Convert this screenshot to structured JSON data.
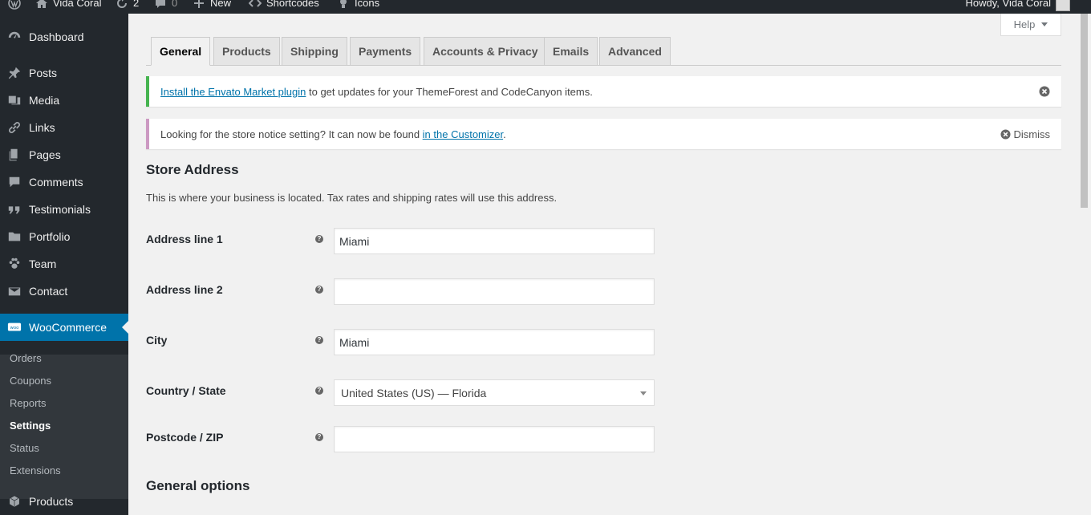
{
  "admin_bar": {
    "site_name": "Vida Coral",
    "updates_count": "2",
    "comments_count": "0",
    "new_label": "New",
    "shortcodes_label": "Shortcodes",
    "icons_label": "Icons",
    "howdy": "Howdy, Vida Coral"
  },
  "sidebar": {
    "menu": [
      {
        "label": "Dashboard",
        "icon": "dashboard-icon"
      },
      {
        "label": "Posts",
        "icon": "pin-icon"
      },
      {
        "label": "Media",
        "icon": "media-icon"
      },
      {
        "label": "Links",
        "icon": "link-icon"
      },
      {
        "label": "Pages",
        "icon": "pages-icon"
      },
      {
        "label": "Comments",
        "icon": "comment-icon"
      },
      {
        "label": "Testimonials",
        "icon": "quote-icon"
      },
      {
        "label": "Portfolio",
        "icon": "folder-icon"
      },
      {
        "label": "Team",
        "icon": "paw-icon"
      },
      {
        "label": "Contact",
        "icon": "mail-icon"
      },
      {
        "label": "WooCommerce",
        "icon": "woo-icon"
      },
      {
        "label": "Products",
        "icon": "cube-icon"
      }
    ],
    "submenu": [
      "Orders",
      "Coupons",
      "Reports",
      "Settings",
      "Status",
      "Extensions"
    ],
    "active_submenu": "Settings"
  },
  "help_label": "Help",
  "tabs": [
    "General",
    "Products",
    "Shipping",
    "Payments",
    "Accounts & Privacy",
    "Emails",
    "Advanced"
  ],
  "active_tab": "General",
  "notices": {
    "envato_link": "Install the Envato Market plugin",
    "envato_text": " to get updates for your ThemeForest and CodeCanyon items.",
    "store_notice_text": "Looking for the store notice setting? It can now be found ",
    "store_notice_link": "in the Customizer",
    "store_notice_end": ".",
    "dismiss_label": "Dismiss"
  },
  "store_address": {
    "title": "Store Address",
    "description": "This is where your business is located. Tax rates and shipping rates will use this address.",
    "fields": {
      "address1_label": "Address line 1",
      "address1_value": "Miami",
      "address2_label": "Address line 2",
      "address2_value": "",
      "city_label": "City",
      "city_value": "Miami",
      "country_label": "Country / State",
      "country_value": "United States (US) — Florida",
      "postcode_label": "Postcode / ZIP",
      "postcode_value": ""
    }
  },
  "general_options_title": "General options",
  "help_tip_glyph": "?",
  "colors": {
    "admin_dark": "#23282d",
    "submenu_bg": "#32373c",
    "accent": "#0073aa",
    "notice_success": "#46b450",
    "notice_woo": "#cc99c2"
  }
}
